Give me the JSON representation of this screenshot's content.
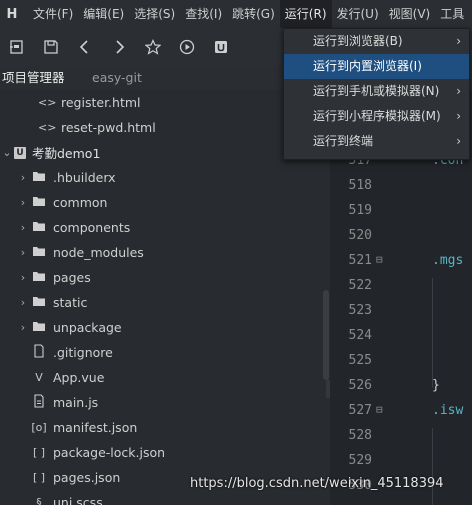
{
  "menubar": {
    "logo": "H",
    "items": [
      "文件(F)",
      "编辑(E)",
      "选择(S)",
      "查找(I)",
      "跳转(G)",
      "运行(R)",
      "发行(U)",
      "视图(V)",
      "工具"
    ]
  },
  "toolbar": {
    "buttons": [
      "save-as-icon",
      "save-icon",
      "back-icon",
      "forward-icon",
      "star-icon",
      "run-icon",
      "project-icon"
    ]
  },
  "panel_tabs": [
    "项目管理器",
    "easy-git"
  ],
  "tree": [
    {
      "label": "register.html",
      "icon": "<>",
      "kind": "file",
      "indent": 38
    },
    {
      "label": "reset-pwd.html",
      "icon": "<>",
      "kind": "file",
      "indent": 38
    },
    {
      "label": "考勤demo1",
      "icon": "U",
      "kind": "project",
      "indent": 0,
      "arrow": "⌄"
    },
    {
      "label": ".hbuilderx",
      "icon": "folder",
      "kind": "folder",
      "indent": 16,
      "arrow": "›"
    },
    {
      "label": "common",
      "icon": "folder",
      "kind": "folder",
      "indent": 16,
      "arrow": "›"
    },
    {
      "label": "components",
      "icon": "folder",
      "kind": "folder",
      "indent": 16,
      "arrow": "›"
    },
    {
      "label": "node_modules",
      "icon": "folder",
      "kind": "folder",
      "indent": 16,
      "arrow": "›"
    },
    {
      "label": "pages",
      "icon": "folder",
      "kind": "folder",
      "indent": 16,
      "arrow": "›"
    },
    {
      "label": "static",
      "icon": "folder",
      "kind": "folder",
      "indent": 16,
      "arrow": "›"
    },
    {
      "label": "unpackage",
      "icon": "folder",
      "kind": "folder",
      "indent": 16,
      "arrow": "›"
    },
    {
      "label": ".gitignore",
      "icon": "file",
      "kind": "file",
      "indent": 30
    },
    {
      "label": "App.vue",
      "icon": "V",
      "kind": "file",
      "indent": 30
    },
    {
      "label": "main.js",
      "icon": "file-js",
      "kind": "file",
      "indent": 30
    },
    {
      "label": "manifest.json",
      "icon": "[o]",
      "kind": "file",
      "indent": 30
    },
    {
      "label": "package-lock.json",
      "icon": "[ ]",
      "kind": "file",
      "indent": 30
    },
    {
      "label": "pages.json",
      "icon": "[ ]",
      "kind": "file",
      "indent": 30
    },
    {
      "label": "uni.scss",
      "icon": "§",
      "kind": "file",
      "indent": 30
    }
  ],
  "editor": {
    "lines": [
      {
        "num": "517",
        "code": ".con",
        "fold": ""
      },
      {
        "num": "518",
        "code": "",
        "fold": ""
      },
      {
        "num": "519",
        "code": "",
        "fold": ""
      },
      {
        "num": "520",
        "code": "",
        "fold": ""
      },
      {
        "num": "521",
        "code": ".mgs",
        "fold": "⊟"
      },
      {
        "num": "522",
        "code": "",
        "fold": ""
      },
      {
        "num": "523",
        "code": "",
        "fold": ""
      },
      {
        "num": "524",
        "code": "",
        "fold": ""
      },
      {
        "num": "525",
        "code": "",
        "fold": ""
      },
      {
        "num": "526",
        "code": "}",
        "fold": ""
      },
      {
        "num": "527",
        "code": ".isw",
        "fold": "⊟"
      },
      {
        "num": "528",
        "code": "",
        "fold": ""
      },
      {
        "num": "529",
        "code": "",
        "fold": ""
      },
      {
        "num": "530",
        "code": "",
        "fold": ""
      }
    ]
  },
  "run_menu": {
    "items": [
      {
        "label": "运行到浏览器(B)",
        "submenu": true
      },
      {
        "label": "运行到内置浏览器(I)",
        "submenu": false,
        "highlight": true
      },
      {
        "label": "运行到手机或模拟器(N)",
        "submenu": true
      },
      {
        "label": "运行到小程序模拟器(M)",
        "submenu": true
      },
      {
        "label": "运行到终端",
        "submenu": true
      }
    ]
  },
  "collapse_glyph": "‹",
  "watermark": "https://blog.csdn.net/weixin_45118394",
  "colors": {
    "menu_highlight": "#1e4f80",
    "code_selector": "#56b6c2",
    "tab_underline": "#2f8fdb"
  }
}
